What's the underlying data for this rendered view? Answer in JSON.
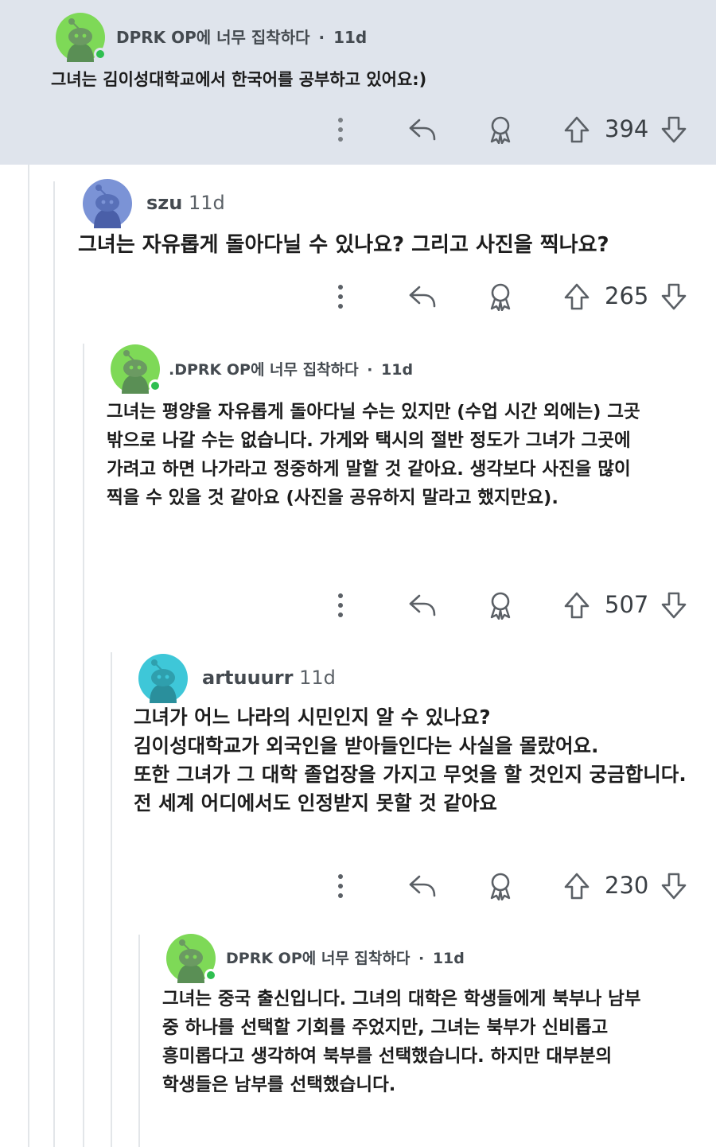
{
  "comments": [
    {
      "username": "DPRK OP에 너무 집착하다",
      "time": "11d",
      "body": [
        "그녀는 김이성대학교에서 한국어를 공부하고 있어요:)"
      ],
      "score": "394"
    },
    {
      "username": "szu",
      "time": "11d",
      "body": [
        "그녀는 자유롭게 돌아다닐 수 있나요? 그리고 사진을 찍나요?"
      ],
      "score": "265"
    },
    {
      "username": ".DPRK OP에 너무 집착하다",
      "time": "11d",
      "body": [
        "그녀는 평양을 자유롭게 돌아다닐 수는 있지만 (수업 시간 외에는) 그곳",
        "밖으로 나갈 수는 없습니다. 가게와 택시의 절반 정도가 그녀가 그곳에",
        "가려고 하면 나가라고 정중하게 말할 것 같아요. 생각보다 사진을 많이",
        "찍을 수 있을 것 같아요 (사진을 공유하지 말라고 했지만요)."
      ],
      "score": "507"
    },
    {
      "username": "artuuurr",
      "time": "11d",
      "body": [
        "그녀가 어느 나라의 시민인지 알 수 있나요?",
        "김이성대학교가 외국인을 받아들인다는 사실을 몰랐어요.",
        "또한 그녀가 그 대학 졸업장을 가지고 무엇을 할 것인지 궁금합니다.",
        "전 세계 어디에서도 인정받지 못할 것 같아요"
      ],
      "score": "230"
    },
    {
      "username": "DPRK OP에 너무 집착하다",
      "time": "11d",
      "body": [
        "그녀는 중국 출신입니다. 그녀의 대학은 학생들에게 북부나 남부",
        "중 하나를 선택할 기회를 주었지만, 그녀는 북부가 신비롭고",
        "흥미롭다고 생각하여 북부를 선택했습니다. 하지만 대부분의",
        "학생들은 남부를 선택했습니다."
      ]
    }
  ],
  "separator": "·",
  "colors": {
    "highlight_bg": "#dfe4ec",
    "op_avatar": "#7ed957",
    "szu_avatar": "#7b93d6",
    "artuuurr_avatar": "#3ec7d8",
    "online": "#2fbf50"
  },
  "icons": [
    "more-icon",
    "reply-icon",
    "award-icon",
    "upvote-icon",
    "downvote-icon"
  ]
}
